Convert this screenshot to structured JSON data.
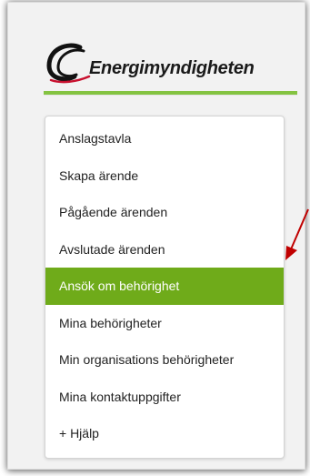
{
  "brand": {
    "name": "Energimyndigheten",
    "accent_color": "#84c341",
    "logo_icon": "swoosh-e-logo-icon"
  },
  "menu": {
    "items": [
      {
        "label": "Anslagstavla",
        "active": false
      },
      {
        "label": "Skapa ärende",
        "active": false
      },
      {
        "label": "Pågående ärenden",
        "active": false
      },
      {
        "label": "Avslutade ärenden",
        "active": false
      },
      {
        "label": "Ansök om behörighet",
        "active": true
      },
      {
        "label": "Mina behörigheter",
        "active": false
      },
      {
        "label": "Min organisations behörigheter",
        "active": false
      },
      {
        "label": "Mina kontaktuppgifter",
        "active": false
      },
      {
        "label": "+ Hjälp",
        "active": false
      }
    ],
    "active_color": "#6fab1a"
  },
  "annotation": {
    "arrow_icon": "red-pointer-arrow-icon",
    "color": "#c00000"
  }
}
